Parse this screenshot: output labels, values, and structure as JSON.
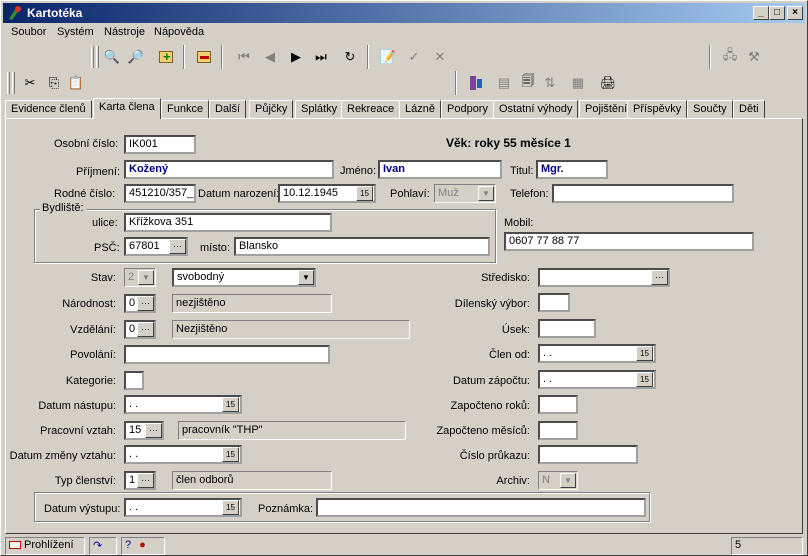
{
  "window": {
    "title": "Kartotéka"
  },
  "menu": [
    "Soubor",
    "Systém",
    "Nástroje",
    "Nápověda"
  ],
  "tabs": [
    "Evidence členů",
    "Karta člena",
    "Funkce",
    "Další",
    "Půjčky",
    "Splátky",
    "Rekreace",
    "Lázně",
    "Podpory",
    "Ostatní výhody",
    "Pojištění",
    "Příspěvky",
    "Součty",
    "Děti"
  ],
  "form": {
    "osobni_cislo_label": "Osobní číslo:",
    "osobni_cislo": "IK001",
    "vek_text": "Věk: roky 55  měsíce 1",
    "prijmeni_label": "Příjmení:",
    "prijmeni": "Kožený",
    "jmeno_label": "Jméno:",
    "jmeno": "Ivan",
    "titul_label": "Titul:",
    "titul": "Mgr.",
    "rodne_cislo_label": "Rodné číslo:",
    "rodne_cislo": "451210/357_",
    "datum_narozeni_label": "Datum narození:",
    "datum_narozeni": "10.12.1945",
    "pohlavi_label": "Pohlaví:",
    "pohlavi": "Muž",
    "telefon_label": "Telefon:",
    "telefon": "",
    "bydliste_label": "Bydliště:",
    "ulice_label": "ulice:",
    "ulice": "Křížkova 351",
    "psc_label": "PSČ:",
    "psc": "67801",
    "misto_label": "místo:",
    "misto": "Blansko",
    "mobil_label": "Mobil:",
    "mobil": "0607 77 88 77",
    "stav_label": "Stav:",
    "stav_code": "2",
    "stav_text": "svobodný",
    "narodnost_label": "Národnost:",
    "narodnost_code": "0",
    "narodnost_text": "nezjištěno",
    "vzdelani_label": "Vzdělání:",
    "vzdelani_code": "0",
    "vzdelani_text": "Nezjištěno",
    "povolani_label": "Povolání:",
    "povolani": "",
    "kategorie_label": "Kategorie:",
    "kategorie": "",
    "datum_nastupu_label": "Datum nástupu:",
    "datum_nastupu": " . .",
    "pracovni_vztah_label": "Pracovní vztah:",
    "pracovni_vztah_code": "15",
    "pracovni_vztah_text": "pracovník \"THP\"",
    "datum_zmeny_label": "Datum změny vztahu:",
    "datum_zmeny": " . .",
    "typ_clenstvi_label": "Typ členství:",
    "typ_clenstvi_code": "1",
    "typ_clenstvi_text": "člen odborů",
    "datum_vystupu_label": "Datum výstupu:",
    "datum_vystupu": " . .",
    "poznamka_label": "Poznámka:",
    "poznamka": "",
    "stredisko_label": "Středisko:",
    "dilensky_vybor_label": "Dílenský výbor:",
    "usek_label": "Úsek:",
    "clen_od_label": "Člen od:",
    "clen_od": " . .",
    "datum_zapoctu_label": "Datum zápočtu:",
    "datum_zapoctu": " . .",
    "zapocteno_roku_label": "Započteno roků:",
    "zapocteno_mesicu_label": "Započteno měsíců:",
    "cislo_prukazu_label": "Číslo průkazu:",
    "archiv_label": "Archiv:",
    "archiv": "N"
  },
  "status": {
    "mode": "Prohlížení",
    "count": "5"
  },
  "calendar_glyph": "15"
}
